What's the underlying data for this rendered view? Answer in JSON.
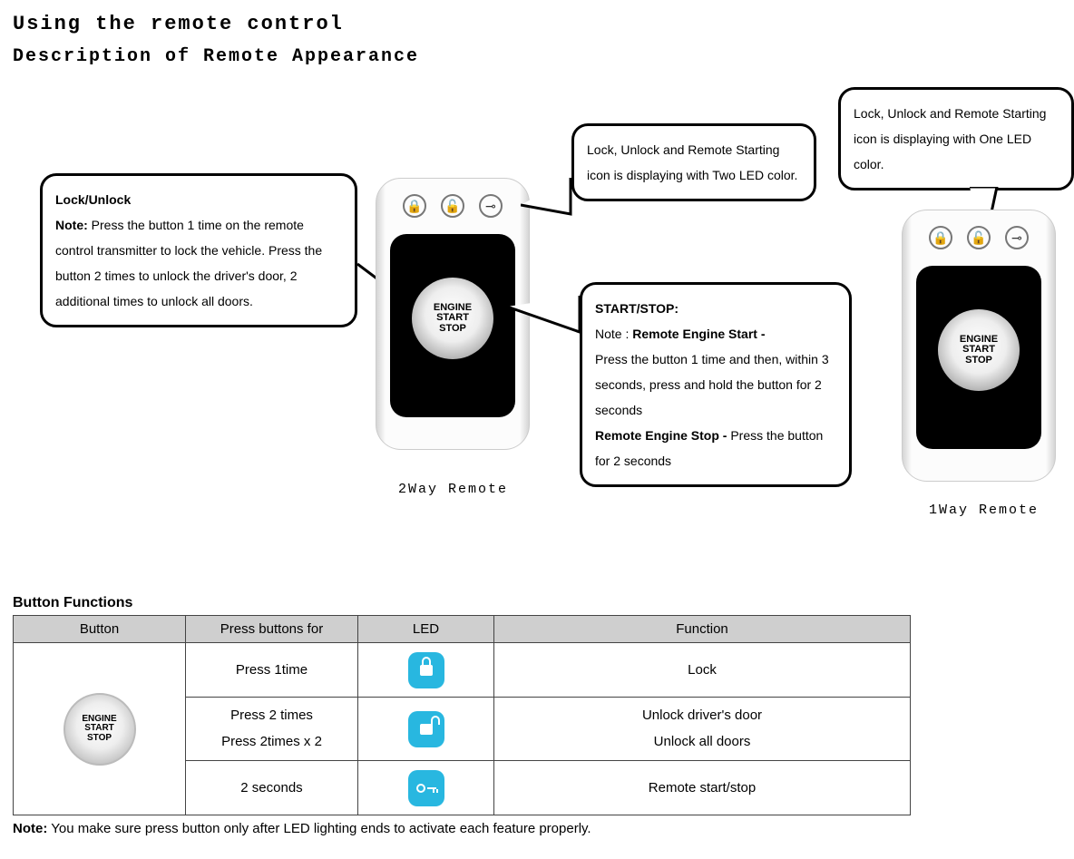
{
  "page": {
    "title": "Using the remote control",
    "section_title": "Description of Remote Appearance",
    "remote_2way_label": "2Way Remote",
    "remote_1way_label": "1Way Remote",
    "engine_button_text": "ENGINE\nSTART\nSTOP"
  },
  "callouts": {
    "lock_unlock": {
      "heading": "Lock/Unlock",
      "note_label": "Note:",
      "note_body": "Press the button 1 time on the remote control transmitter to lock the vehicle. Press the button 2 times to unlock the driver's door, 2 additional times to unlock all doors."
    },
    "two_led": "Lock, Unlock and Remote Starting icon is displaying with Two LED color.",
    "one_led": "Lock, Unlock and Remote Starting icon is displaying with One LED color.",
    "start_stop": {
      "heading": "START/STOP:",
      "note_label": "Note :",
      "start_label": "Remote Engine Start -",
      "start_body": "Press the button 1 time and then, within 3 seconds, press and hold the button for 2 seconds",
      "stop_label": "Remote Engine Stop -",
      "stop_body": "Press the button for 2 seconds"
    }
  },
  "table": {
    "title": "Button Functions",
    "headers": [
      "Button",
      "Press buttons for",
      "LED",
      "Function"
    ],
    "row_button_label": "ENGINE\nSTART\nSTOP",
    "rows": [
      {
        "press": "Press 1time",
        "led": "lock",
        "function": "Lock"
      },
      {
        "press_line1": "Press 2 times",
        "press_line2": "Press 2times x 2",
        "led": "unlock",
        "function_line1": "Unlock driver's door",
        "function_line2": "Unlock all doors"
      },
      {
        "press": "2 seconds",
        "led": "key",
        "function": "Remote start/stop"
      }
    ],
    "footer_note_label": "Note:",
    "footer_note_body": "You make sure press button only after LED lighting ends to activate each feature properly."
  }
}
